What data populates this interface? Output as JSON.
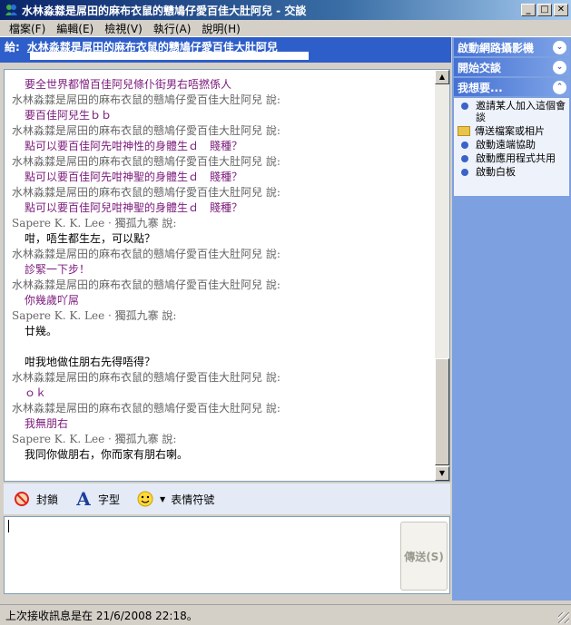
{
  "window": {
    "title": "水林淼㵘是屌田的麻布衣鼠的戆鳩仔愛百佳大肚阿兒 - 交談"
  },
  "menu": [
    {
      "label": "檔案(F)"
    },
    {
      "label": "編輯(E)"
    },
    {
      "label": "檢視(V)"
    },
    {
      "label": "執行(A)"
    },
    {
      "label": "說明(H)"
    }
  ],
  "to_bar": {
    "label": "給:",
    "name": "水林淼㵘是屌田的麻布衣鼠的戆鳩仔愛百佳大肚阿兒"
  },
  "chat": [
    {
      "kind": "text",
      "color": "purple",
      "text": "要全世界都憎百佳阿兒條仆街男右唔撚係人"
    },
    {
      "kind": "sender",
      "text": "水林淼㵘是屌田的麻布衣鼠的戆鳩仔愛百佳大肚阿兒 說:"
    },
    {
      "kind": "text",
      "color": "purple",
      "text": "要百佳阿兒生ｂｂ"
    },
    {
      "kind": "sender",
      "text": "水林淼㵘是屌田的麻布衣鼠的戆鳩仔愛百佳大肚阿兒 說:"
    },
    {
      "kind": "text",
      "color": "purple",
      "text": "點可以要百佳阿先咁神性的身體生ｄ　賤種？"
    },
    {
      "kind": "sender",
      "text": "水林淼㵘是屌田的麻布衣鼠的戆鳩仔愛百佳大肚阿兒 說:"
    },
    {
      "kind": "text",
      "color": "purple",
      "text": "點可以要百佳阿先咁神聖的身體生ｄ　賤種？"
    },
    {
      "kind": "sender",
      "text": "水林淼㵘是屌田的麻布衣鼠的戆鳩仔愛百佳大肚阿兒 說:"
    },
    {
      "kind": "text",
      "color": "purple",
      "text": "點可以要百佳阿兒咁神聖的身體生ｄ　賤種？"
    },
    {
      "kind": "sender",
      "text": "Sapere K. K. Lee ‧ 獨孤九寨 說:"
    },
    {
      "kind": "text",
      "color": "black",
      "text": "咁，唔生都生左，可以點？"
    },
    {
      "kind": "sender",
      "text": "水林淼㵘是屌田的麻布衣鼠的戆鳩仔愛百佳大肚阿兒 說:"
    },
    {
      "kind": "text",
      "color": "purple",
      "text": "診緊一下步！"
    },
    {
      "kind": "sender",
      "text": "水林淼㵘是屌田的麻布衣鼠的戆鳩仔愛百佳大肚阿兒 說:"
    },
    {
      "kind": "text",
      "color": "purple",
      "text": "你幾歲吖屌"
    },
    {
      "kind": "sender",
      "text": "Sapere K. K. Lee ‧ 獨孤九寨 說:"
    },
    {
      "kind": "text",
      "color": "black",
      "text": "廿幾。"
    },
    {
      "kind": "blank",
      "text": ""
    },
    {
      "kind": "text",
      "color": "black",
      "text": "咁我地做住朋右先得唔得？"
    },
    {
      "kind": "sender",
      "text": "水林淼㵘是屌田的麻布衣鼠的戆鳩仔愛百佳大肚阿兒 說:"
    },
    {
      "kind": "text",
      "color": "purple",
      "text": "ｏｋ"
    },
    {
      "kind": "sender",
      "text": "水林淼㵘是屌田的麻布衣鼠的戆鳩仔愛百佳大肚阿兒 說:"
    },
    {
      "kind": "text",
      "color": "purple",
      "text": "我無朋右"
    },
    {
      "kind": "sender",
      "text": "Sapere K. K. Lee ‧ 獨孤九寨 說:"
    },
    {
      "kind": "text",
      "color": "black",
      "text": "我同你做朋右，你而家有朋右喇。"
    }
  ],
  "format_bar": {
    "block_label": "封鎖",
    "font_label": "字型",
    "emoticon_label": "表情符號"
  },
  "input": {
    "send_label": "傳送(S)"
  },
  "sidebar": {
    "webcam_header": "啟動網路攝影機",
    "start_talk_header": "開始交談",
    "want_header": "我想要...",
    "items": [
      {
        "icon": "bullet",
        "label": "邀請某人加入這個會談"
      },
      {
        "icon": "folder",
        "label": "傳送檔案或相片"
      },
      {
        "icon": "bullet",
        "label": "啟動遠端協助"
      },
      {
        "icon": "bullet",
        "label": "啟動應用程式共用"
      },
      {
        "icon": "bullet",
        "label": "啟動白板"
      }
    ]
  },
  "status": {
    "text": "上次接收訊息是在 21/6/2008 22:18。"
  },
  "colors": {
    "purple_text": "#7b1a7b",
    "to_bar": "#2e5ec9",
    "sidebar": "#7da0e0"
  }
}
